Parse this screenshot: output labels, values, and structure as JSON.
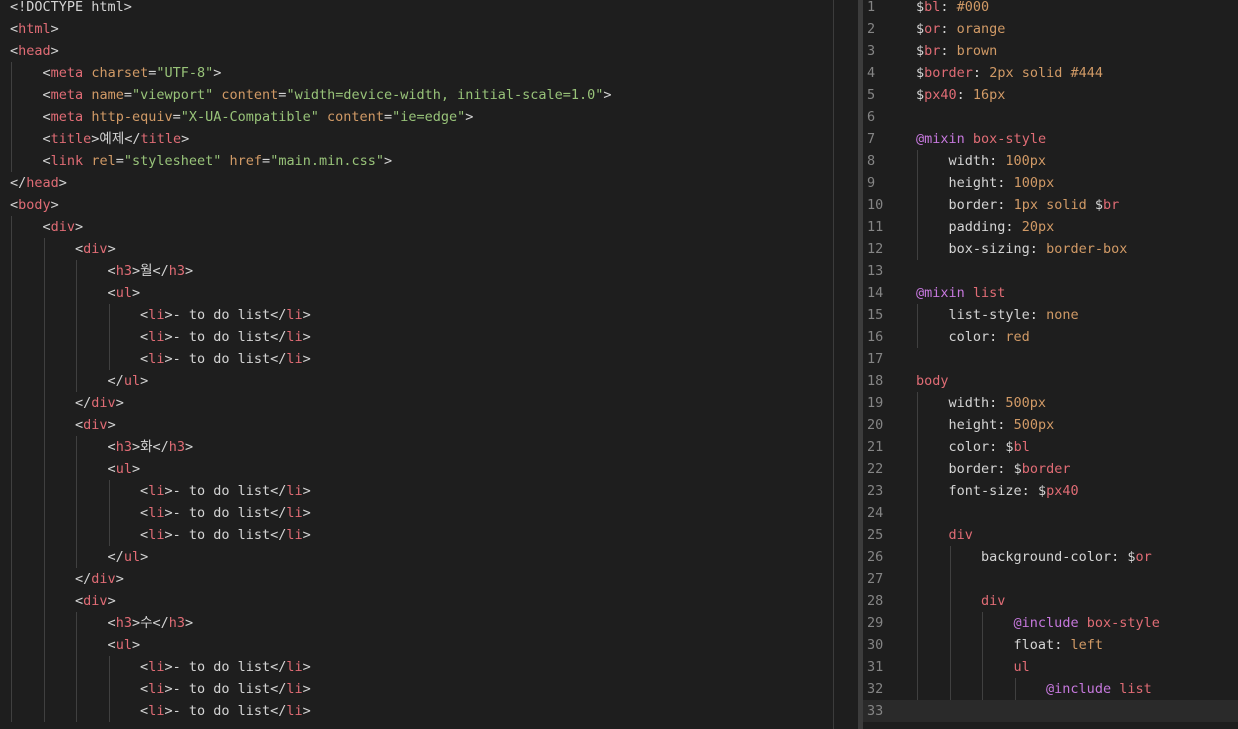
{
  "left_editor": {
    "lines": [
      [
        [
          "<!DOCTYPE html>",
          "text"
        ]
      ],
      [
        [
          "<",
          "punc"
        ],
        [
          "html",
          "tag"
        ],
        [
          ">",
          "punc"
        ]
      ],
      [
        [
          "<",
          "punc"
        ],
        [
          "head",
          "tag"
        ],
        [
          ">",
          "punc"
        ]
      ],
      [
        [
          "    ",
          "text"
        ],
        [
          "<",
          "punc"
        ],
        [
          "meta",
          "tag"
        ],
        [
          " ",
          "text"
        ],
        [
          "charset",
          "attr"
        ],
        [
          "=",
          "punc"
        ],
        [
          "\"UTF-8\"",
          "str"
        ],
        [
          ">",
          "punc"
        ]
      ],
      [
        [
          "    ",
          "text"
        ],
        [
          "<",
          "punc"
        ],
        [
          "meta",
          "tag"
        ],
        [
          " ",
          "text"
        ],
        [
          "name",
          "attr"
        ],
        [
          "=",
          "punc"
        ],
        [
          "\"viewport\"",
          "str"
        ],
        [
          " ",
          "text"
        ],
        [
          "content",
          "attr"
        ],
        [
          "=",
          "punc"
        ],
        [
          "\"width=device-width, initial-scale=1.0\"",
          "str"
        ],
        [
          ">",
          "punc"
        ]
      ],
      [
        [
          "    ",
          "text"
        ],
        [
          "<",
          "punc"
        ],
        [
          "meta",
          "tag"
        ],
        [
          " ",
          "text"
        ],
        [
          "http-equiv",
          "attr"
        ],
        [
          "=",
          "punc"
        ],
        [
          "\"X-UA-Compatible\"",
          "str"
        ],
        [
          " ",
          "text"
        ],
        [
          "content",
          "attr"
        ],
        [
          "=",
          "punc"
        ],
        [
          "\"ie=edge\"",
          "str"
        ],
        [
          ">",
          "punc"
        ]
      ],
      [
        [
          "    ",
          "text"
        ],
        [
          "<",
          "punc"
        ],
        [
          "title",
          "tag"
        ],
        [
          ">예제</",
          "punc"
        ],
        [
          "title",
          "tag"
        ],
        [
          ">",
          "punc"
        ]
      ],
      [
        [
          "    ",
          "text"
        ],
        [
          "<",
          "punc"
        ],
        [
          "link",
          "tag"
        ],
        [
          " ",
          "text"
        ],
        [
          "rel",
          "attr"
        ],
        [
          "=",
          "punc"
        ],
        [
          "\"stylesheet\"",
          "str"
        ],
        [
          " ",
          "text"
        ],
        [
          "href",
          "attr"
        ],
        [
          "=",
          "punc"
        ],
        [
          "\"main.min.css\"",
          "str"
        ],
        [
          ">",
          "punc"
        ]
      ],
      [
        [
          "</",
          "punc"
        ],
        [
          "head",
          "tag"
        ],
        [
          ">",
          "punc"
        ]
      ],
      [
        [
          "<",
          "punc"
        ],
        [
          "body",
          "tag"
        ],
        [
          ">",
          "punc"
        ]
      ],
      [
        [
          "    ",
          "text"
        ],
        [
          "<",
          "punc"
        ],
        [
          "div",
          "tag"
        ],
        [
          ">",
          "punc"
        ]
      ],
      [
        [
          "        ",
          "text"
        ],
        [
          "<",
          "punc"
        ],
        [
          "div",
          "tag"
        ],
        [
          ">",
          "punc"
        ]
      ],
      [
        [
          "            ",
          "text"
        ],
        [
          "<",
          "punc"
        ],
        [
          "h3",
          "tag"
        ],
        [
          ">월</",
          "punc"
        ],
        [
          "h3",
          "tag"
        ],
        [
          ">",
          "punc"
        ]
      ],
      [
        [
          "            ",
          "text"
        ],
        [
          "<",
          "punc"
        ],
        [
          "ul",
          "tag"
        ],
        [
          ">",
          "punc"
        ]
      ],
      [
        [
          "                ",
          "text"
        ],
        [
          "<",
          "punc"
        ],
        [
          "li",
          "tag"
        ],
        [
          ">- to do list</",
          "punc"
        ],
        [
          "li",
          "tag"
        ],
        [
          ">",
          "punc"
        ]
      ],
      [
        [
          "                ",
          "text"
        ],
        [
          "<",
          "punc"
        ],
        [
          "li",
          "tag"
        ],
        [
          ">- to do list</",
          "punc"
        ],
        [
          "li",
          "tag"
        ],
        [
          ">",
          "punc"
        ]
      ],
      [
        [
          "                ",
          "text"
        ],
        [
          "<",
          "punc"
        ],
        [
          "li",
          "tag"
        ],
        [
          ">- to do list</",
          "punc"
        ],
        [
          "li",
          "tag"
        ],
        [
          ">",
          "punc"
        ]
      ],
      [
        [
          "            ",
          "text"
        ],
        [
          "</",
          "punc"
        ],
        [
          "ul",
          "tag"
        ],
        [
          ">",
          "punc"
        ]
      ],
      [
        [
          "        ",
          "text"
        ],
        [
          "</",
          "punc"
        ],
        [
          "div",
          "tag"
        ],
        [
          ">",
          "punc"
        ]
      ],
      [
        [
          "        ",
          "text"
        ],
        [
          "<",
          "punc"
        ],
        [
          "div",
          "tag"
        ],
        [
          ">",
          "punc"
        ]
      ],
      [
        [
          "            ",
          "text"
        ],
        [
          "<",
          "punc"
        ],
        [
          "h3",
          "tag"
        ],
        [
          ">화</",
          "punc"
        ],
        [
          "h3",
          "tag"
        ],
        [
          ">",
          "punc"
        ]
      ],
      [
        [
          "            ",
          "text"
        ],
        [
          "<",
          "punc"
        ],
        [
          "ul",
          "tag"
        ],
        [
          ">",
          "punc"
        ]
      ],
      [
        [
          "                ",
          "text"
        ],
        [
          "<",
          "punc"
        ],
        [
          "li",
          "tag"
        ],
        [
          ">- to do list</",
          "punc"
        ],
        [
          "li",
          "tag"
        ],
        [
          ">",
          "punc"
        ]
      ],
      [
        [
          "                ",
          "text"
        ],
        [
          "<",
          "punc"
        ],
        [
          "li",
          "tag"
        ],
        [
          ">- to do list</",
          "punc"
        ],
        [
          "li",
          "tag"
        ],
        [
          ">",
          "punc"
        ]
      ],
      [
        [
          "                ",
          "text"
        ],
        [
          "<",
          "punc"
        ],
        [
          "li",
          "tag"
        ],
        [
          ">- to do list</",
          "punc"
        ],
        [
          "li",
          "tag"
        ],
        [
          ">",
          "punc"
        ]
      ],
      [
        [
          "            ",
          "text"
        ],
        [
          "</",
          "punc"
        ],
        [
          "ul",
          "tag"
        ],
        [
          ">",
          "punc"
        ]
      ],
      [
        [
          "        ",
          "text"
        ],
        [
          "</",
          "punc"
        ],
        [
          "div",
          "tag"
        ],
        [
          ">",
          "punc"
        ]
      ],
      [
        [
          "        ",
          "text"
        ],
        [
          "<",
          "punc"
        ],
        [
          "div",
          "tag"
        ],
        [
          ">",
          "punc"
        ]
      ],
      [
        [
          "            ",
          "text"
        ],
        [
          "<",
          "punc"
        ],
        [
          "h3",
          "tag"
        ],
        [
          ">수</",
          "punc"
        ],
        [
          "h3",
          "tag"
        ],
        [
          ">",
          "punc"
        ]
      ],
      [
        [
          "            ",
          "text"
        ],
        [
          "<",
          "punc"
        ],
        [
          "ul",
          "tag"
        ],
        [
          ">",
          "punc"
        ]
      ],
      [
        [
          "                ",
          "text"
        ],
        [
          "<",
          "punc"
        ],
        [
          "li",
          "tag"
        ],
        [
          ">- to do list</",
          "punc"
        ],
        [
          "li",
          "tag"
        ],
        [
          ">",
          "punc"
        ]
      ],
      [
        [
          "                ",
          "text"
        ],
        [
          "<",
          "punc"
        ],
        [
          "li",
          "tag"
        ],
        [
          ">- to do list</",
          "punc"
        ],
        [
          "li",
          "tag"
        ],
        [
          ">",
          "punc"
        ]
      ],
      [
        [
          "                ",
          "text"
        ],
        [
          "<",
          "punc"
        ],
        [
          "li",
          "tag"
        ],
        [
          ">- to do list</",
          "punc"
        ],
        [
          "li",
          "tag"
        ],
        [
          ">",
          "punc"
        ]
      ]
    ]
  },
  "right_editor": {
    "lines": [
      {
        "n": "1",
        "t": [
          [
            "$",
            "dollar"
          ],
          [
            "bl",
            "var"
          ],
          [
            ": ",
            "punc"
          ],
          [
            "#000",
            "val"
          ]
        ]
      },
      {
        "n": "2",
        "t": [
          [
            "$",
            "dollar"
          ],
          [
            "or",
            "var"
          ],
          [
            ": ",
            "punc"
          ],
          [
            "orange",
            "val"
          ]
        ]
      },
      {
        "n": "3",
        "t": [
          [
            "$",
            "dollar"
          ],
          [
            "br",
            "var"
          ],
          [
            ": ",
            "punc"
          ],
          [
            "brown",
            "val"
          ]
        ]
      },
      {
        "n": "4",
        "t": [
          [
            "$",
            "dollar"
          ],
          [
            "border",
            "var"
          ],
          [
            ": ",
            "punc"
          ],
          [
            "2px solid #444",
            "val"
          ]
        ]
      },
      {
        "n": "5",
        "t": [
          [
            "$",
            "dollar"
          ],
          [
            "px40",
            "var"
          ],
          [
            ": ",
            "punc"
          ],
          [
            "16px",
            "val"
          ]
        ]
      },
      {
        "n": "6",
        "t": []
      },
      {
        "n": "7",
        "t": [
          [
            "@mixin",
            "kw"
          ],
          [
            " ",
            "text"
          ],
          [
            "box-style",
            "sel"
          ]
        ]
      },
      {
        "n": "8",
        "t": [
          [
            "    ",
            "text"
          ],
          [
            "width",
            "prop"
          ],
          [
            ": ",
            "punc"
          ],
          [
            "100px",
            "val"
          ]
        ]
      },
      {
        "n": "9",
        "t": [
          [
            "    ",
            "text"
          ],
          [
            "height",
            "prop"
          ],
          [
            ": ",
            "punc"
          ],
          [
            "100px",
            "val"
          ]
        ]
      },
      {
        "n": "10",
        "t": [
          [
            "    ",
            "text"
          ],
          [
            "border",
            "prop"
          ],
          [
            ": ",
            "punc"
          ],
          [
            "1px solid ",
            "val"
          ],
          [
            "$",
            "dollar"
          ],
          [
            "br",
            "var"
          ]
        ]
      },
      {
        "n": "11",
        "t": [
          [
            "    ",
            "text"
          ],
          [
            "padding",
            "prop"
          ],
          [
            ": ",
            "punc"
          ],
          [
            "20px",
            "val"
          ]
        ]
      },
      {
        "n": "12",
        "t": [
          [
            "    ",
            "text"
          ],
          [
            "box-sizing",
            "prop"
          ],
          [
            ": ",
            "punc"
          ],
          [
            "border-box",
            "val"
          ]
        ]
      },
      {
        "n": "13",
        "t": []
      },
      {
        "n": "14",
        "t": [
          [
            "@mixin",
            "kw"
          ],
          [
            " ",
            "text"
          ],
          [
            "list",
            "sel"
          ]
        ]
      },
      {
        "n": "15",
        "t": [
          [
            "    ",
            "text"
          ],
          [
            "list-style",
            "prop"
          ],
          [
            ": ",
            "punc"
          ],
          [
            "none",
            "val"
          ]
        ]
      },
      {
        "n": "16",
        "t": [
          [
            "    ",
            "text"
          ],
          [
            "color",
            "prop"
          ],
          [
            ": ",
            "punc"
          ],
          [
            "red",
            "val"
          ]
        ]
      },
      {
        "n": "17",
        "t": []
      },
      {
        "n": "18",
        "t": [
          [
            "body",
            "sel"
          ]
        ]
      },
      {
        "n": "19",
        "t": [
          [
            "    ",
            "text"
          ],
          [
            "width",
            "prop"
          ],
          [
            ": ",
            "punc"
          ],
          [
            "500px",
            "val"
          ]
        ]
      },
      {
        "n": "20",
        "t": [
          [
            "    ",
            "text"
          ],
          [
            "height",
            "prop"
          ],
          [
            ": ",
            "punc"
          ],
          [
            "500px",
            "val"
          ]
        ]
      },
      {
        "n": "21",
        "t": [
          [
            "    ",
            "text"
          ],
          [
            "color",
            "prop"
          ],
          [
            ": ",
            "punc"
          ],
          [
            "$",
            "dollar"
          ],
          [
            "bl",
            "var"
          ]
        ]
      },
      {
        "n": "22",
        "t": [
          [
            "    ",
            "text"
          ],
          [
            "border",
            "prop"
          ],
          [
            ": ",
            "punc"
          ],
          [
            "$",
            "dollar"
          ],
          [
            "border",
            "var"
          ]
        ]
      },
      {
        "n": "23",
        "t": [
          [
            "    ",
            "text"
          ],
          [
            "font-size",
            "prop"
          ],
          [
            ": ",
            "punc"
          ],
          [
            "$",
            "dollar"
          ],
          [
            "px40",
            "var"
          ]
        ]
      },
      {
        "n": "24",
        "t": []
      },
      {
        "n": "25",
        "t": [
          [
            "    ",
            "text"
          ],
          [
            "div",
            "sel"
          ]
        ]
      },
      {
        "n": "26",
        "t": [
          [
            "        ",
            "text"
          ],
          [
            "background-color",
            "prop"
          ],
          [
            ": ",
            "punc"
          ],
          [
            "$",
            "dollar"
          ],
          [
            "or",
            "var"
          ]
        ]
      },
      {
        "n": "27",
        "t": []
      },
      {
        "n": "28",
        "t": [
          [
            "        ",
            "text"
          ],
          [
            "div",
            "sel"
          ]
        ]
      },
      {
        "n": "29",
        "t": [
          [
            "            ",
            "text"
          ],
          [
            "@include",
            "kw"
          ],
          [
            " ",
            "text"
          ],
          [
            "box-style",
            "sel"
          ]
        ]
      },
      {
        "n": "30",
        "t": [
          [
            "            ",
            "text"
          ],
          [
            "float",
            "prop"
          ],
          [
            ": ",
            "punc"
          ],
          [
            "left",
            "val"
          ]
        ]
      },
      {
        "n": "31",
        "t": [
          [
            "            ",
            "text"
          ],
          [
            "ul",
            "sel"
          ]
        ]
      },
      {
        "n": "32",
        "t": [
          [
            "                ",
            "text"
          ],
          [
            "@include",
            "kw"
          ],
          [
            " ",
            "text"
          ],
          [
            "list",
            "sel"
          ]
        ]
      },
      {
        "n": "33",
        "t": []
      }
    ]
  },
  "colors": {
    "background": "#1e1e1e",
    "tag": "#e06c75",
    "attribute": "#d19a66",
    "string": "#98c379",
    "keyword": "#c678dd",
    "value": "#d19a66",
    "line_number": "#858585"
  }
}
